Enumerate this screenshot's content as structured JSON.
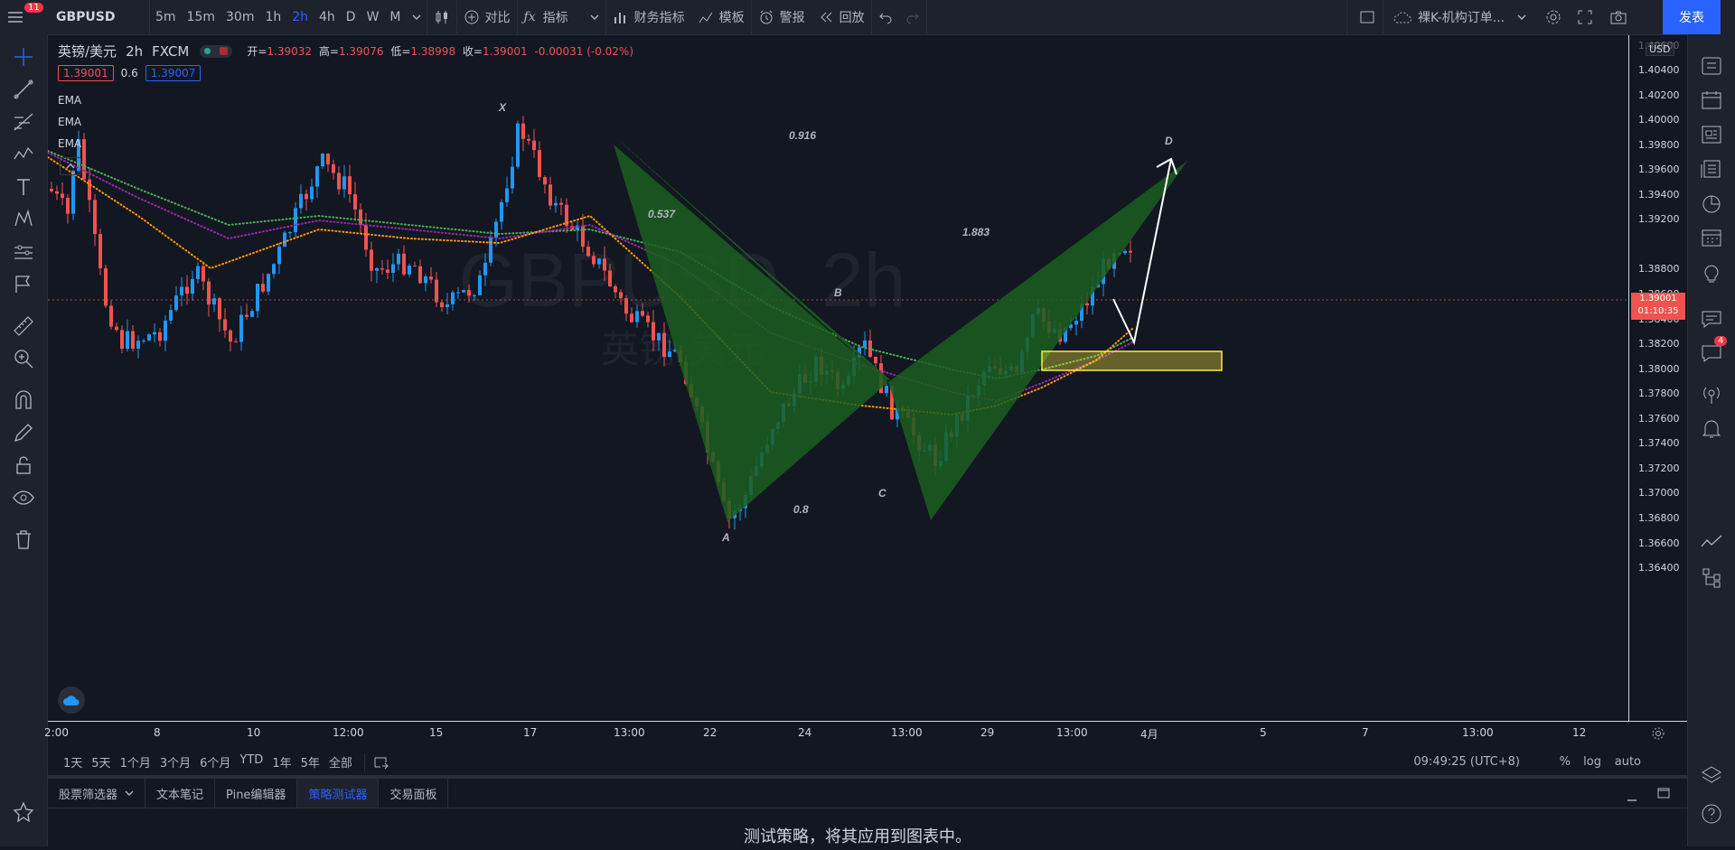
{
  "topbar": {
    "menu_badge": "11",
    "symbol": "GBPUSD",
    "intervals": [
      "5m",
      "15m",
      "30m",
      "1h",
      "2h",
      "4h",
      "D",
      "W",
      "M"
    ],
    "active_interval": "2h",
    "compare": "对比",
    "indicators": "指标",
    "financials": "财务指标",
    "templates": "模板",
    "alert": "警报",
    "replay": "回放",
    "layout_name": "裸K-机构订单...",
    "publish": "发表"
  },
  "legend": {
    "title": "英镑/美元",
    "interval": "2h",
    "source": "FXCM",
    "open_label": "开=",
    "open": "1.39032",
    "high_label": "高=",
    "high": "1.39076",
    "low_label": "低=",
    "low": "1.38998",
    "close_label": "收=",
    "close": "1.39001",
    "change": "-0.00031 (-0.02%)",
    "bid": "1.39001",
    "spread": "0.6",
    "ask": "1.39007",
    "indicators": [
      "EMA",
      "EMA",
      "EMA"
    ]
  },
  "watermark": {
    "symbol": "GBPUSD, 2h",
    "name": "英镑/美元"
  },
  "pattern": {
    "points": [
      "X",
      "A",
      "B",
      "C",
      "D"
    ],
    "ratios": [
      "0.916",
      "0.537",
      "1.883",
      "0.8"
    ]
  },
  "price_axis": {
    "currency": "USD",
    "ticks": [
      "1.40600",
      "1.40400",
      "1.40200",
      "1.40000",
      "1.39800",
      "1.39600",
      "1.39400",
      "1.39200",
      "1.38800",
      "1.38600",
      "1.38400",
      "1.38200",
      "1.38000",
      "1.37800",
      "1.37600",
      "1.37400",
      "1.37200",
      "1.37000",
      "1.36800",
      "1.36600",
      "1.36400"
    ],
    "current_price": "1.39001",
    "countdown": "01:10:35"
  },
  "time_axis": {
    "ticks": [
      "2:00",
      "8",
      "10",
      "12:00",
      "15",
      "17",
      "13:00",
      "22",
      "24",
      "13:00",
      "29",
      "13:00",
      "4月",
      "5",
      "7",
      "13:00",
      "12"
    ]
  },
  "ranges": {
    "items": [
      "1天",
      "5天",
      "1个月",
      "3个月",
      "6个月",
      "YTD",
      "1年",
      "5年",
      "全部"
    ],
    "clock": "09:49:25 (UTC+8)",
    "percent": "%",
    "log": "log",
    "auto": "auto"
  },
  "bottom": {
    "tabs": [
      "股票筛选器",
      "文本笔记",
      "Pine编辑器",
      "策略测试器",
      "交易面板"
    ],
    "active_tab": "策略测试器",
    "message": "测试策略，将其应用到图表中。"
  },
  "righttoolbar": {
    "chat_badge": "4"
  },
  "colors": {
    "background": "#131722",
    "up": "#2196f3",
    "down": "#ef5350",
    "ema1": "#4caf50",
    "ema2": "#9c27b0",
    "ema3": "#ff9800",
    "pattern": "#1b5e20",
    "accent": "#2962ff"
  }
}
